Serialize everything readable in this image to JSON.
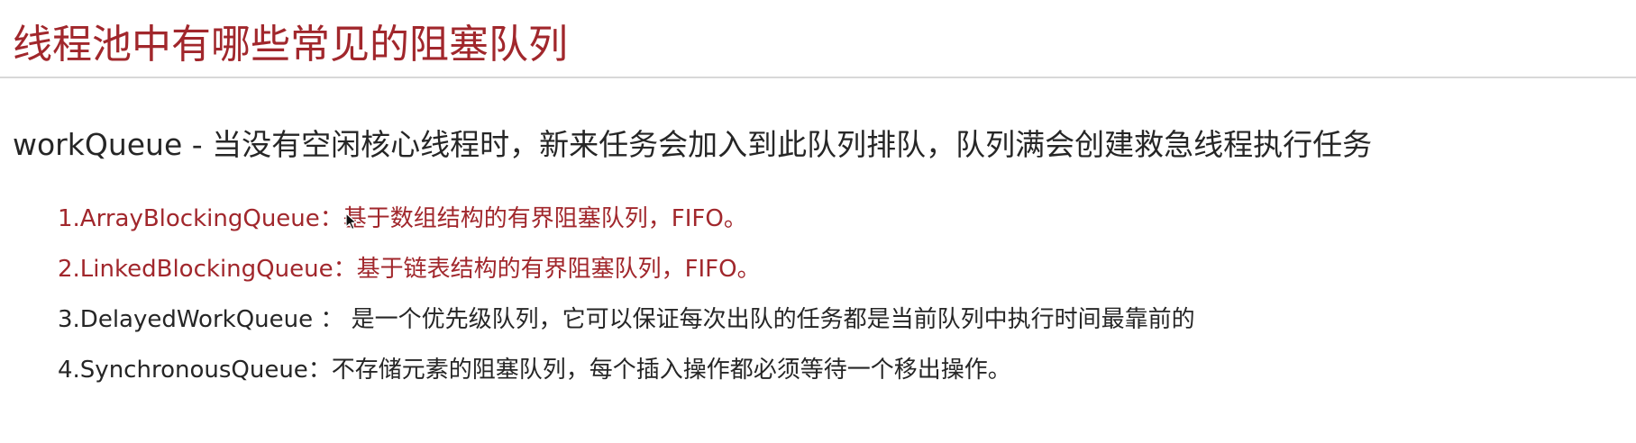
{
  "page": {
    "title": "线程池中有哪些常见的阻塞队列",
    "lead": "workQueue - 当没有空闲核心线程时，新来任务会加入到此队列排队，队列满会创建救急线程执行任务",
    "items": [
      {
        "text": "1.ArrayBlockingQueue：基于数组结构的有界阻塞队列，FIFO。",
        "color": "#a1272c"
      },
      {
        "text": "2.LinkedBlockingQueue：基于链表结构的有界阻塞队列，FIFO。",
        "color": "#a1272c"
      },
      {
        "text": "3.DelayedWorkQueue ： 是一个优先级队列，它可以保证每次出队的任务都是当前队列中执行时间最靠前的",
        "color": "#262626"
      },
      {
        "text": "4.SynchronousQueue：不存储元素的阻塞队列，每个插入操作都必须等待一个移出操作。",
        "color": "#262626"
      }
    ]
  },
  "colors": {
    "accent": "#a1272c",
    "text": "#262626",
    "divider": "#d8d8d8",
    "background": "#ffffff"
  },
  "icons": {
    "cursor": "mouse-pointer-icon"
  }
}
